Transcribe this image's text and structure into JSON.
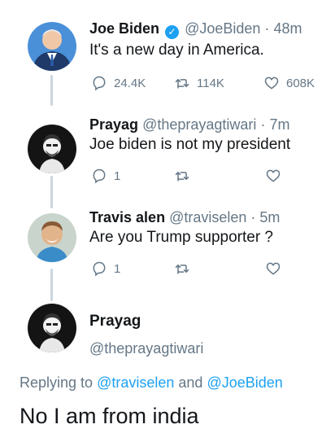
{
  "tweets": [
    {
      "name": "Joe Biden",
      "verified": true,
      "handle": "@JoeBiden",
      "time": "48m",
      "text": "It's a new day in America.",
      "reply_count": "24.4K",
      "retweet_count": "114K",
      "like_count": "608K"
    },
    {
      "name": "Prayag",
      "verified": false,
      "handle": "@theprayagtiwari",
      "time": "7m",
      "text": "Joe biden is not my president",
      "reply_count": "1",
      "retweet_count": "",
      "like_count": ""
    },
    {
      "name": "Travis alen",
      "verified": false,
      "handle": "@traviselen",
      "time": "5m",
      "text": "Are you Trump supporter ?",
      "reply_count": "1",
      "retweet_count": "",
      "like_count": ""
    }
  ],
  "focused": {
    "name": "Prayag",
    "handle": "@theprayagtiwari",
    "replying_prefix": "Replying to",
    "replying_user1": "@traviselen",
    "replying_and": "and",
    "replying_user2": "@JoeBiden",
    "text": "No I am from india"
  },
  "separator": "·",
  "colors": {
    "link": "#1da1f2",
    "muted": "#657786",
    "thread_line": "#ccd6dd"
  },
  "icons": {
    "reply": "reply-icon",
    "retweet": "retweet-icon",
    "like": "like-icon",
    "verified": "verified-badge-icon"
  }
}
